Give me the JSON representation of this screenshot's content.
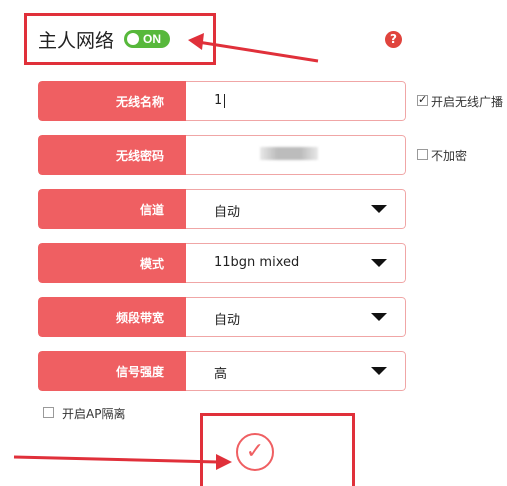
{
  "header": {
    "title": "主人网络",
    "toggle_label": "ON",
    "help": "?"
  },
  "rows": [
    {
      "label": "无线名称",
      "value": "1",
      "type": "text"
    },
    {
      "label": "无线密码",
      "value": "",
      "type": "password"
    },
    {
      "label": "信道",
      "value": "自动",
      "type": "select"
    },
    {
      "label": "模式",
      "value": "11bgn mixed",
      "type": "select"
    },
    {
      "label": "频段带宽",
      "value": "自动",
      "type": "select"
    },
    {
      "label": "信号强度",
      "value": "高",
      "type": "select"
    }
  ],
  "options": {
    "broadcast": {
      "label": "开启无线广播",
      "checked": true
    },
    "no_encrypt": {
      "label": "不加密",
      "checked": false
    },
    "ap_isolation": {
      "label": "开启AP隔离",
      "checked": false
    }
  },
  "submit": {
    "icon": "checkmark-icon",
    "glyph": "✓"
  },
  "colors": {
    "accent": "#ef5f62",
    "annotation": "#e0303a",
    "toggle_on": "#57b83b"
  }
}
